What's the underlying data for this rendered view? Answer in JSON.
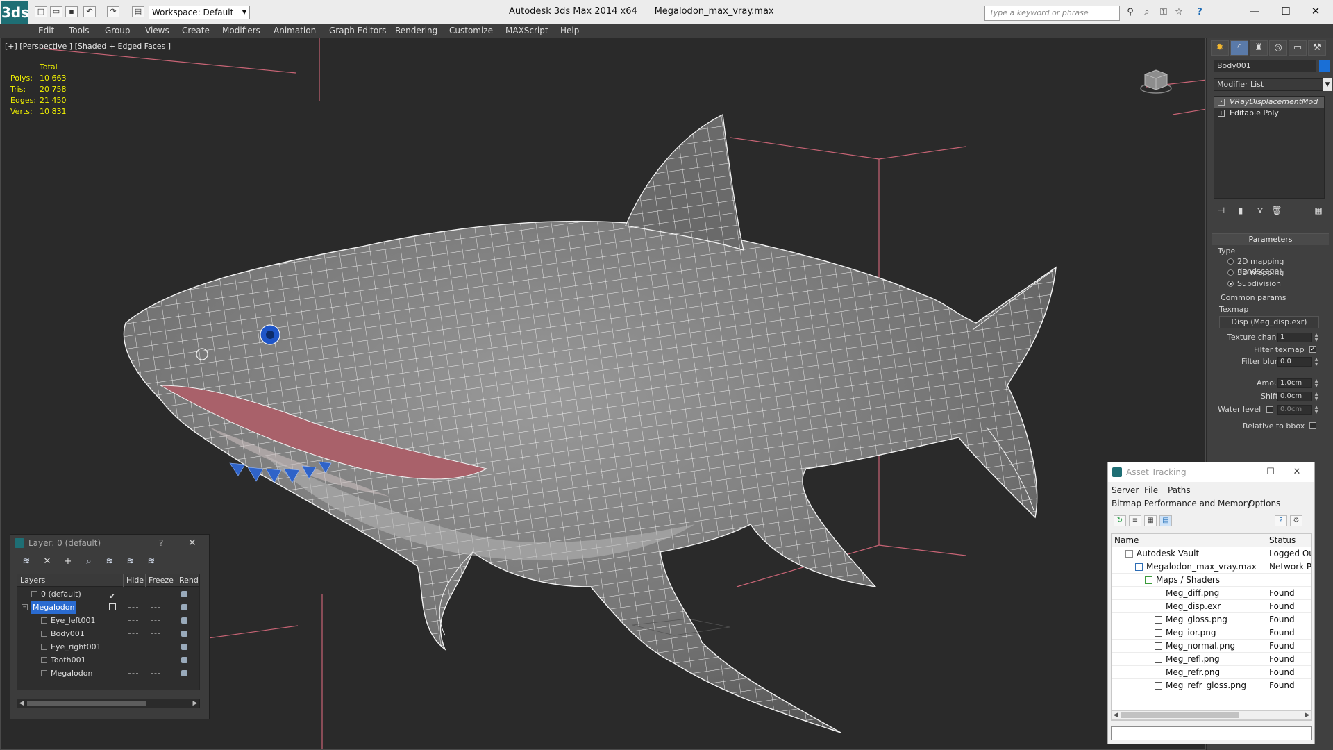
{
  "titlebar": {
    "app_logo": "3ds",
    "workspace": "Workspace: Default",
    "app_title": "Autodesk 3ds Max  2014 x64",
    "file_title": "Megalodon_max_vray.max",
    "search_placeholder": "Type a keyword or phrase",
    "quick_access_icons": [
      "new-icon",
      "open-icon",
      "save-icon",
      "undo-icon",
      "redo-icon",
      "project-icon"
    ],
    "toolbar_icons": [
      "binoculars-icon",
      "star-icon",
      "help-icon"
    ],
    "window_controls": [
      "minimize",
      "maximize",
      "close"
    ]
  },
  "menubar": {
    "items": [
      "Edit",
      "Tools",
      "Group",
      "Views",
      "Create",
      "Modifiers",
      "Animation",
      "Graph Editors",
      "Rendering",
      "Customize",
      "MAXScript",
      "Help"
    ]
  },
  "viewport": {
    "label": "[+] [Perspective ] [Shaded + Edged Faces ]",
    "stats": {
      "total_label": "Total",
      "polys_label": "Polys:",
      "polys": "10 663",
      "tris_label": "Tris:",
      "tris": "20 758",
      "edges_label": "Edges:",
      "edges": "21 450",
      "verts_label": "Verts:",
      "verts": "10 831"
    },
    "colors": {
      "background": "#2a2a2a",
      "wire": "#ffffff",
      "bbox": "#d06a7a",
      "skin": "#8a8a8a",
      "eye": "#1e55c8"
    }
  },
  "command_panel": {
    "tab_icons": [
      "create-icon",
      "modify-icon",
      "hierarchy-icon",
      "motion-icon",
      "display-icon",
      "utilities-icon"
    ],
    "object_name": "Body001",
    "object_color": "#1a6fd6",
    "modifier_list": "Modifier List",
    "stack": [
      {
        "label": "VRayDisplacementMod",
        "active": true
      },
      {
        "label": "Editable Poly",
        "active": false
      }
    ],
    "params": {
      "header": "Parameters",
      "type_label": "Type",
      "type_options": [
        "2D mapping (landscape)",
        "3D mapping",
        "Subdivision"
      ],
      "type_selected": "Subdivision",
      "common_label": "Common params",
      "texmap_label": "Texmap",
      "texmap_button": "Disp (Meg_disp.exr)",
      "texture_chan_label": "Texture chan",
      "texture_chan": "1",
      "filter_texmap_label": "Filter texmap",
      "filter_texmap_checked": true,
      "filter_blur_label": "Filter blur",
      "filter_blur": "0.0",
      "amount_label": "Amount",
      "amount": "1.0cm",
      "shift_label": "Shift",
      "shift": "0.0cm",
      "water_level_label": "Water level",
      "water_level": "0.0cm",
      "relative_bbox_label": "Relative to bbox"
    }
  },
  "layer_window": {
    "title": "Layer: 0 (default)",
    "help": "?",
    "close": "✕",
    "tool_icons": [
      "layer-add-icon",
      "delete-icon",
      "add-icon",
      "select-icon",
      "highlight-icon",
      "hide-all-icon",
      "freeze-all-icon"
    ],
    "columns": [
      "Layers",
      "Hide",
      "Freeze",
      "Render"
    ],
    "rows": [
      {
        "name": "0 (default)",
        "indent": 1,
        "mark": "check",
        "selected": false
      },
      {
        "name": "Megalodon",
        "indent": 0,
        "mark": "box",
        "selected": true
      },
      {
        "name": "Eye_left001",
        "indent": 2,
        "mark": "",
        "selected": false
      },
      {
        "name": "Body001",
        "indent": 2,
        "mark": "",
        "selected": false
      },
      {
        "name": "Eye_right001",
        "indent": 2,
        "mark": "",
        "selected": false
      },
      {
        "name": "Tooth001",
        "indent": 2,
        "mark": "",
        "selected": false
      },
      {
        "name": "Megalodon",
        "indent": 2,
        "mark": "",
        "selected": false
      }
    ]
  },
  "asset_window": {
    "title": "Asset Tracking",
    "menus": [
      "Server",
      "File",
      "Paths",
      "Bitmap Performance and Memory",
      "Options"
    ],
    "tool_icons": [
      "refresh-icon",
      "list-icon",
      "thumbnail-icon",
      "table-icon",
      "help-icon",
      "settings-icon"
    ],
    "columns": [
      "Name",
      "Status"
    ],
    "rows": [
      {
        "name": "Autodesk Vault",
        "status": "Logged Out",
        "indent": 1,
        "icon": "vault"
      },
      {
        "name": "Megalodon_max_vray.max",
        "status": "Network Path",
        "indent": 2,
        "icon": "file"
      },
      {
        "name": "Maps / Shaders",
        "status": "",
        "indent": 3,
        "icon": "folder"
      },
      {
        "name": "Meg_diff.png",
        "status": "Found",
        "indent": 4,
        "icon": "image"
      },
      {
        "name": "Meg_disp.exr",
        "status": "Found",
        "indent": 4,
        "icon": "image"
      },
      {
        "name": "Meg_gloss.png",
        "status": "Found",
        "indent": 4,
        "icon": "image"
      },
      {
        "name": "Meg_ior.png",
        "status": "Found",
        "indent": 4,
        "icon": "image"
      },
      {
        "name": "Meg_normal.png",
        "status": "Found",
        "indent": 4,
        "icon": "image"
      },
      {
        "name": "Meg_refl.png",
        "status": "Found",
        "indent": 4,
        "icon": "image"
      },
      {
        "name": "Meg_refr.png",
        "status": "Found",
        "indent": 4,
        "icon": "image"
      },
      {
        "name": "Meg_refr_gloss.png",
        "status": "Found",
        "indent": 4,
        "icon": "image"
      }
    ]
  }
}
